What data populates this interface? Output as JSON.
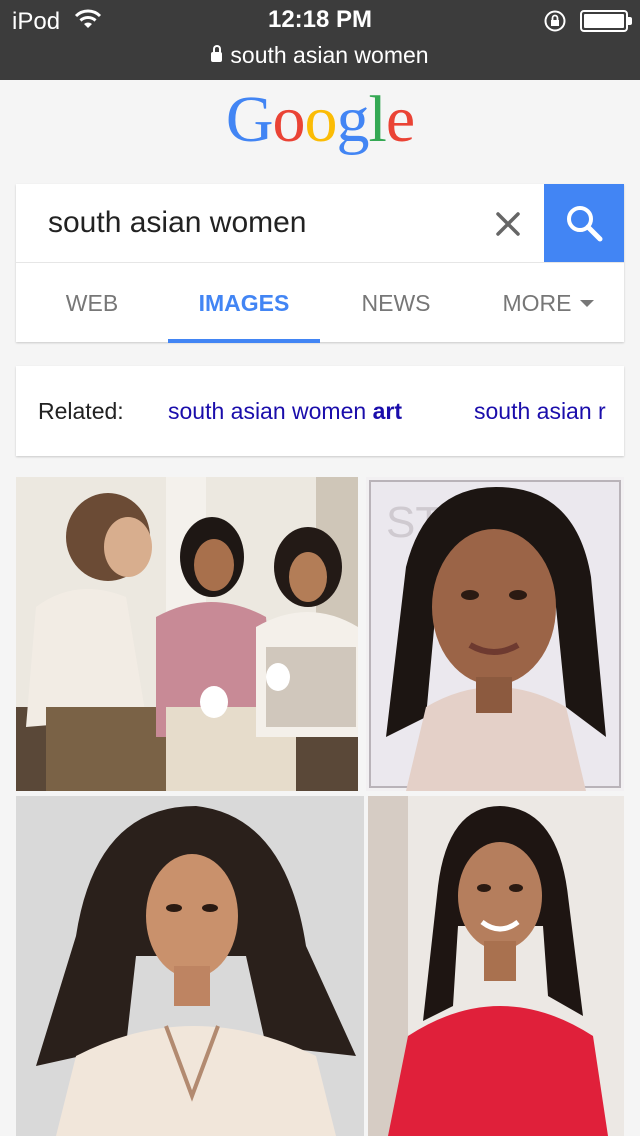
{
  "status_bar": {
    "carrier": "iPod",
    "time": "12:18 PM",
    "url": "south asian women"
  },
  "logo": {
    "letters": [
      "G",
      "o",
      "o",
      "g",
      "l",
      "e"
    ],
    "colors": [
      "#4285f4",
      "#ea4335",
      "#fbbc05",
      "#4285f4",
      "#34a853",
      "#ea4335"
    ]
  },
  "search": {
    "query": "south asian women",
    "clear_icon": "close-icon",
    "submit_icon": "search-icon",
    "accent": "#4285f4"
  },
  "tabs": {
    "web": "WEB",
    "images": "IMAGES",
    "news": "NEWS",
    "more": "MORE",
    "active": "IMAGES"
  },
  "related": {
    "label": "Related:",
    "suggestions": [
      {
        "normal": "south asian women ",
        "bold": "art"
      },
      {
        "normal": "south asian r",
        "bold": ""
      }
    ]
  },
  "results": {
    "images": [
      {
        "icon": "photo-three-women-icon"
      },
      {
        "icon": "photo-portrait-woman-icon"
      },
      {
        "icon": "photo-model-woman-icon"
      },
      {
        "icon": "photo-woman-red-shirt-icon"
      }
    ]
  }
}
